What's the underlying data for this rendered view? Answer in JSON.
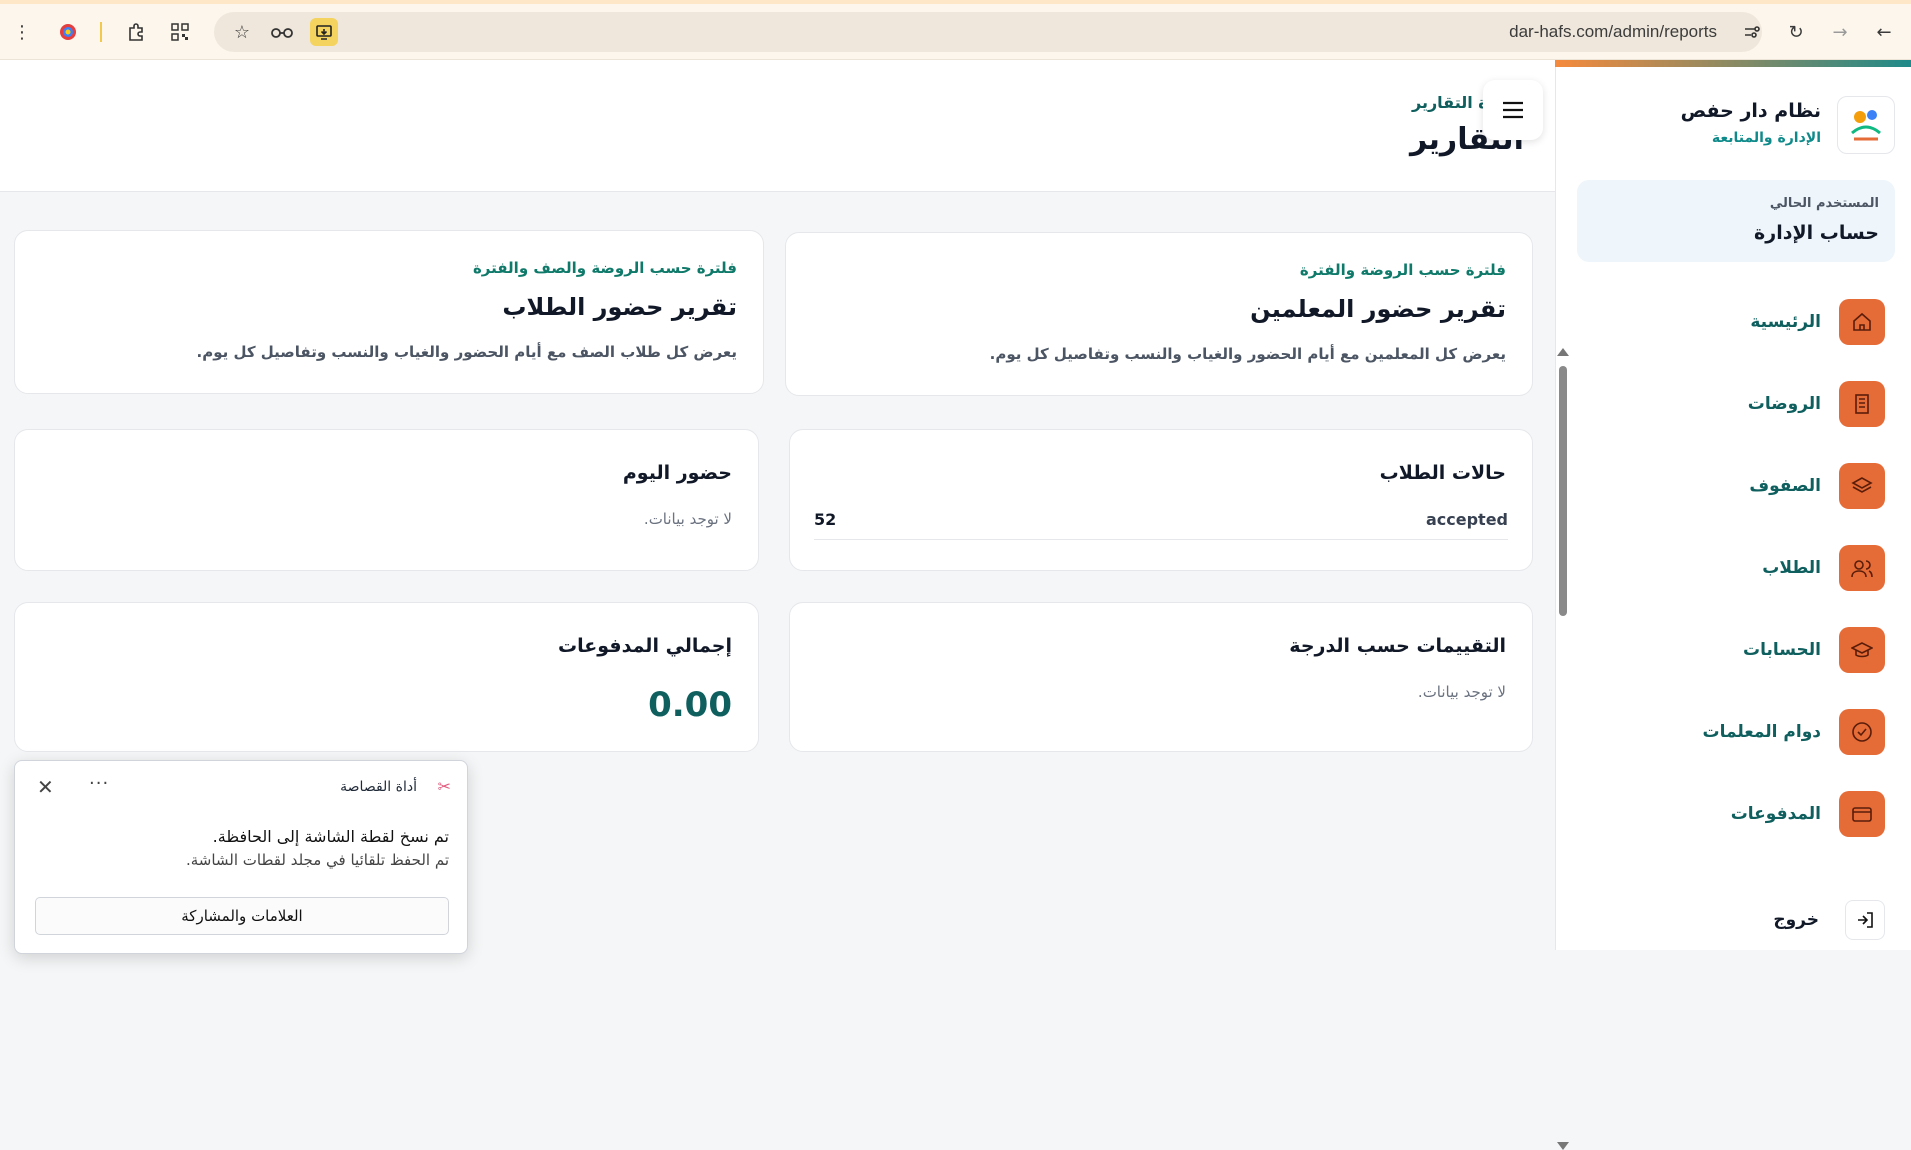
{
  "browser": {
    "url": "dar-hafs.com/admin/reports"
  },
  "sidebar": {
    "brand_title": "نظام دار حفص",
    "brand_subtitle": "الإدارة والمتابعة",
    "user_label": "المستخدم الحالي",
    "user_name": "حساب الإدارة",
    "items": [
      {
        "label": "الرئيسية",
        "icon": "home-icon"
      },
      {
        "label": "الروضات",
        "icon": "building-icon"
      },
      {
        "label": "الصفوف",
        "icon": "layers-icon"
      },
      {
        "label": "الطلاب",
        "icon": "users-icon"
      },
      {
        "label": "الحسابات",
        "icon": "graduation-cap-icon"
      },
      {
        "label": "دوام المعلمات",
        "icon": "check-circle-icon"
      },
      {
        "label": "المدفوعات",
        "icon": "credit-card-icon"
      }
    ],
    "logout_label": "خروج"
  },
  "header": {
    "breadcrumb": "ة التقارير",
    "title": "التقارير"
  },
  "report_cards": {
    "teachers": {
      "kicker": "فلترة حسب الروضة والفترة",
      "title": "تقرير حضور المعلمين",
      "description": "يعرض كل المعلمين مع أيام الحضور والغياب والنسب وتفاصيل كل يوم."
    },
    "students": {
      "kicker": "فلترة حسب الروضة والصف والفترة",
      "title": "تقرير حضور الطلاب",
      "description": "يعرض كل طلاب الصف مع أيام الحضور والغياب والنسب وتفاصيل كل يوم."
    }
  },
  "stats": {
    "student_statuses": {
      "title": "حالات الطلاب",
      "rows": [
        {
          "name": "accepted",
          "count": "52"
        }
      ]
    },
    "today_attendance": {
      "title": "حضور اليوم",
      "empty": "لا توجد بيانات."
    },
    "grades": {
      "title": "التقييمات حسب الدرجة",
      "empty": "لا توجد بيانات."
    },
    "payments": {
      "title": "إجمالي المدفوعات",
      "amount": "0.00"
    }
  },
  "snip": {
    "title": "أداة القصاصة",
    "line1": "تم نسخ لقطة الشاشة إلى الحافظة.",
    "line2": "تم الحفظ تلقائيا في مجلد لقطات الشاشة.",
    "button": "العلامات والمشاركة",
    "more": "···",
    "close": "✕"
  },
  "colors": {
    "accent_orange": "#e56b37",
    "accent_teal": "#0f5f5f"
  }
}
